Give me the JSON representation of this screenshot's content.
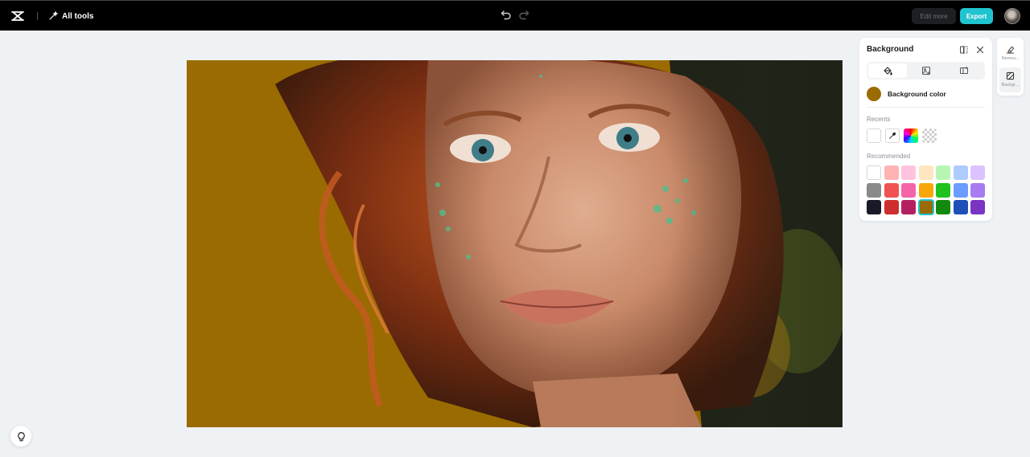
{
  "topbar": {
    "all_tools_label": "All tools",
    "edit_more_label": "Edit more",
    "export_label": "Export"
  },
  "canvas": {
    "background_color": "#9a6b00"
  },
  "panel": {
    "title": "Background",
    "background_color_label": "Background color",
    "selected_color": "#9a6b00",
    "recents_label": "Recents",
    "recommended_label": "Recommended",
    "recommended_colors": [
      "#ffffff",
      "#ffb3b3",
      "#ffc3de",
      "#ffe5c0",
      "#b8f5b2",
      "#aecbff",
      "#dcc3ff",
      "#8a8a8a",
      "#f05252",
      "#f464a8",
      "#f7a70a",
      "#1fc21f",
      "#6b9cff",
      "#a77cf2",
      "#181b27",
      "#cf2e2e",
      "#b3225f",
      "#9a6b00",
      "#138a0e",
      "#1f4fb8",
      "#7a35c4"
    ]
  },
  "rail": {
    "item1_label": "Remov...",
    "item2_label": "Backgr..."
  },
  "colors": {
    "accent": "#20c4cf",
    "topbar": "#000000",
    "workspace": "#eff2f5"
  }
}
